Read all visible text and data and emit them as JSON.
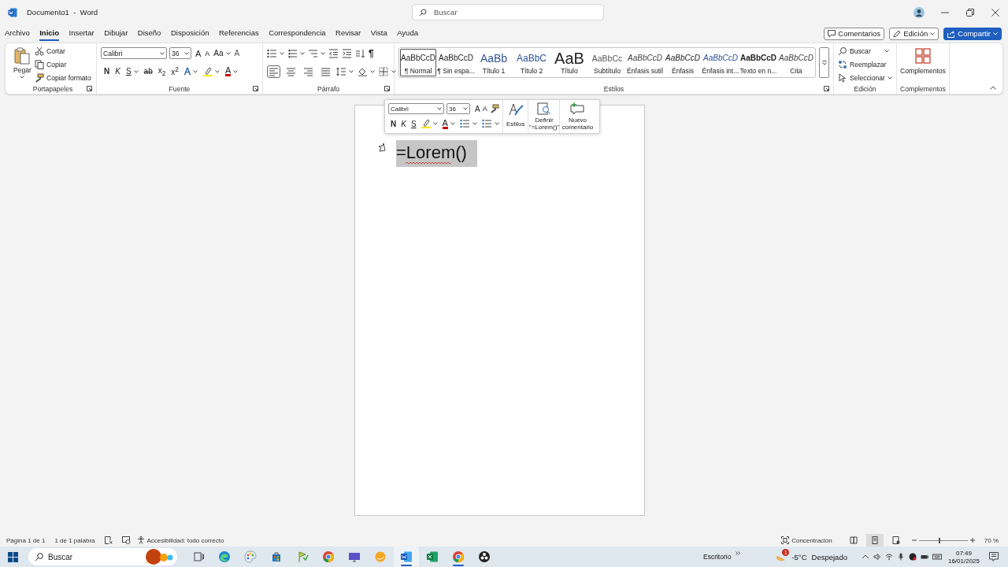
{
  "window": {
    "title": "Documento1  -  Word",
    "search_placeholder": "Buscar"
  },
  "menu_tabs": [
    {
      "label": "Archivo",
      "selected": false
    },
    {
      "label": "Inicio",
      "selected": true
    },
    {
      "label": "Insertar",
      "selected": false
    },
    {
      "label": "Dibujar",
      "selected": false
    },
    {
      "label": "Diseño",
      "selected": false
    },
    {
      "label": "Disposición",
      "selected": false
    },
    {
      "label": "Referencias",
      "selected": false
    },
    {
      "label": "Correspondencia",
      "selected": false
    },
    {
      "label": "Revisar",
      "selected": false
    },
    {
      "label": "Vista",
      "selected": false
    },
    {
      "label": "Ayuda",
      "selected": false
    }
  ],
  "header_buttons": [
    {
      "label": "Comentarios",
      "kind": "comments"
    },
    {
      "label": "Edición",
      "kind": "editing"
    },
    {
      "label": "Compartir",
      "kind": "share"
    }
  ],
  "clipboard": {
    "paste": "Pegar",
    "items": [
      {
        "label": "Cortar",
        "kind": "cut"
      },
      {
        "label": "Copiar",
        "kind": "copy"
      },
      {
        "label": "Copiar formato",
        "kind": "painter"
      }
    ],
    "group": "Portapapeles"
  },
  "font": {
    "name": "Calibri",
    "size": "36",
    "row1": [
      {
        "kind": "grow",
        "label": "A"
      },
      {
        "kind": "shrink",
        "label": "A"
      },
      {
        "kind": "case",
        "label": "Aa"
      },
      {
        "kind": "clear",
        "label": "A"
      }
    ],
    "row2": [
      {
        "kind": "bold",
        "label": "N"
      },
      {
        "kind": "italic",
        "label": "K"
      },
      {
        "kind": "underline",
        "label": "S"
      },
      {
        "kind": "strike",
        "label": "ab"
      },
      {
        "kind": "subscript",
        "label": "x$_{2}$"
      },
      {
        "kind": "superscript",
        "label": "x$^{2}$"
      },
      {
        "kind": "effects",
        "label": "A"
      },
      {
        "kind": "highlight"
      },
      {
        "kind": "color",
        "label": "A"
      }
    ],
    "group": "Fuente"
  },
  "paragraph": {
    "pilcrow": "¶",
    "align_buttons": [
      {
        "selected": true
      },
      {
        "selected": false
      },
      {
        "selected": false
      },
      {
        "selected": false
      }
    ],
    "group": "Párrafo"
  },
  "styles": {
    "items": [
      {
        "preview": "AaBbCcD",
        "label": "¶ Normal",
        "kind": "normal",
        "selected": true
      },
      {
        "preview": "AaBbCcD",
        "label": "¶ Sin espa...",
        "kind": "normal",
        "selected": false
      },
      {
        "preview": "AaBb",
        "label": "Título 1",
        "kind": "heading1",
        "selected": false
      },
      {
        "preview": "AaBbC",
        "label": "Título 2",
        "kind": "heading2",
        "selected": false
      },
      {
        "preview": "AaB",
        "label": "Título",
        "kind": "title",
        "selected": false
      },
      {
        "preview": "AaBbCc",
        "label": "Subtítulo",
        "kind": "subtitle",
        "selected": false
      },
      {
        "preview": "AaBbCcD",
        "label": "Énfasis sutil",
        "kind": "subtle",
        "selected": false
      },
      {
        "preview": "AaBbCcD",
        "label": "Énfasis",
        "kind": "emphasis",
        "selected": false
      },
      {
        "preview": "AaBbCcD",
        "label": "Énfasis int...",
        "kind": "intense",
        "selected": false
      },
      {
        "preview": "AaBbCcD",
        "label": "Texto en n...",
        "kind": "strong",
        "selected": false
      },
      {
        "preview": "AaBbCcD",
        "label": "Cita",
        "kind": "quote",
        "selected": false
      }
    ],
    "group": "Estilos"
  },
  "editing": {
    "items": [
      {
        "label": "Buscar",
        "kind": "find"
      },
      {
        "label": "Reemplazar",
        "kind": "replace"
      },
      {
        "label": "Seleccionar",
        "kind": "select"
      }
    ],
    "group": "Edición"
  },
  "addins": {
    "button": "Complementos",
    "group": "Complementos"
  },
  "mini_toolbar": {
    "font": "Calibri",
    "size": "36",
    "grow": "A",
    "shrink": "A",
    "format_buttons": [
      {
        "kind": "bold",
        "label": "N"
      },
      {
        "kind": "italic",
        "label": "K"
      },
      {
        "kind": "underline",
        "label": "S"
      },
      {
        "kind": "highlight"
      },
      {
        "kind": "color",
        "label": "A"
      }
    ],
    "styles": "Estilos",
    "define": "Definir \"=Lorem()\"",
    "comment": "Nuevo comentario"
  },
  "document": {
    "text": "=Lorem()",
    "selected": true,
    "spelling_error": true
  },
  "status_bar": {
    "items": [
      {
        "label": "Página 1 de 1",
        "kind": "text"
      },
      {
        "label": "1 de 1 palabra",
        "kind": "text"
      },
      {
        "kind": "proofing"
      },
      {
        "kind": "macro"
      },
      {
        "label": "Accesibilidad: todo correcto",
        "kind": "accessibility"
      }
    ],
    "focus": "Concentración",
    "views": [
      {
        "selected": false
      },
      {
        "selected": true
      },
      {
        "selected": false
      }
    ],
    "zoom_slider": {
      "level": 0.42
    },
    "zoom": "70 %"
  },
  "taskbar": {
    "search_placeholder": "Buscar",
    "apps": [
      {
        "kind": "taskview",
        "active": false,
        "running": false
      },
      {
        "kind": "edge",
        "active": false,
        "running": false
      },
      {
        "kind": "paint",
        "active": false,
        "running": false
      },
      {
        "kind": "store",
        "active": false,
        "running": false
      },
      {
        "kind": "notes",
        "active": false,
        "running": false
      },
      {
        "kind": "chrome",
        "active": false,
        "running": false
      },
      {
        "kind": "display",
        "active": false,
        "running": false
      },
      {
        "kind": "orange",
        "active": false,
        "running": false
      },
      {
        "kind": "word",
        "active": true,
        "running": true
      },
      {
        "kind": "excel",
        "active": false,
        "running": false
      },
      {
        "kind": "chrome",
        "active": false,
        "running": true
      },
      {
        "kind": "obs",
        "active": false,
        "running": false
      }
    ],
    "desktop": "Escritorio",
    "weather_badge": "1",
    "temperature": "-5°C",
    "condition": "Despejado",
    "time": "07:49",
    "date": "16/01/2025"
  }
}
